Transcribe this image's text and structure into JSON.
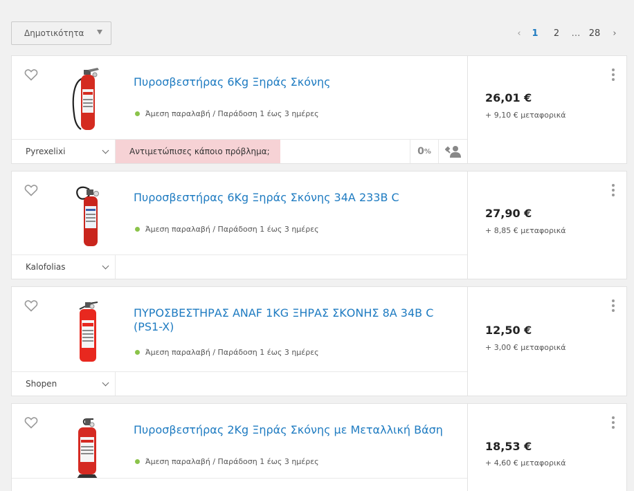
{
  "sort": {
    "label": "Δημοτικότητα"
  },
  "pagination": {
    "prev": "‹",
    "current": "1",
    "page2": "2",
    "dots": "…",
    "last": "28",
    "next": "›"
  },
  "products": [
    {
      "title": "Πυροσβεστήρας 6Kg Ξηράς Σκόνης",
      "availability": "Άμεση παραλαβή / Παράδοση 1 έως 3 ημέρες",
      "shop": "Pyrexelixi",
      "problem": "Αντιμετώπισες κάποιο πρόβλημα;",
      "rating_value": "0",
      "rating_unit": "%",
      "price": "26,01 €",
      "shipping": "+ 9,10 € μεταφορικά"
    },
    {
      "title": "Πυροσβεστήρας 6Kg Ξηράς Σκόνης 34A 233B C",
      "availability": "Άμεση παραλαβή / Παράδοση 1 έως 3 ημέρες",
      "shop": "Kalofolias",
      "price": "27,90 €",
      "shipping": "+ 8,85 € μεταφορικά"
    },
    {
      "title": "ΠΥΡΟΣΒΕΣΤΗΡΑΣ ΑΝΑF 1KG ΞΗΡΑΣ ΣΚΟΝΗΣ 8Α 34Β C (PS1-X)",
      "availability": "Άμεση παραλαβή / Παράδοση 1 έως 3 ημέρες",
      "shop": "Shopen",
      "price": "12,50 €",
      "shipping": "+ 3,00 € μεταφορικά"
    },
    {
      "title": "Πυροσβεστήρας 2Kg Ξηράς Σκόνης με Μεταλλική Βάση",
      "availability": "Άμεση παραλαβή / Παράδοση 1 έως 3 ημέρες",
      "price": "18,53 €",
      "shipping": "+ 4,60 € μεταφορικά"
    }
  ],
  "colors": {
    "link": "#1e7bc1",
    "available": "#8bc34a",
    "problem_bg": "#f6d2d5"
  },
  "icons": {
    "favorite": "heart-icon",
    "menu": "kebab-menu-icon",
    "support": "user-wrench-icon",
    "dropdown": "chevron-down-icon"
  }
}
